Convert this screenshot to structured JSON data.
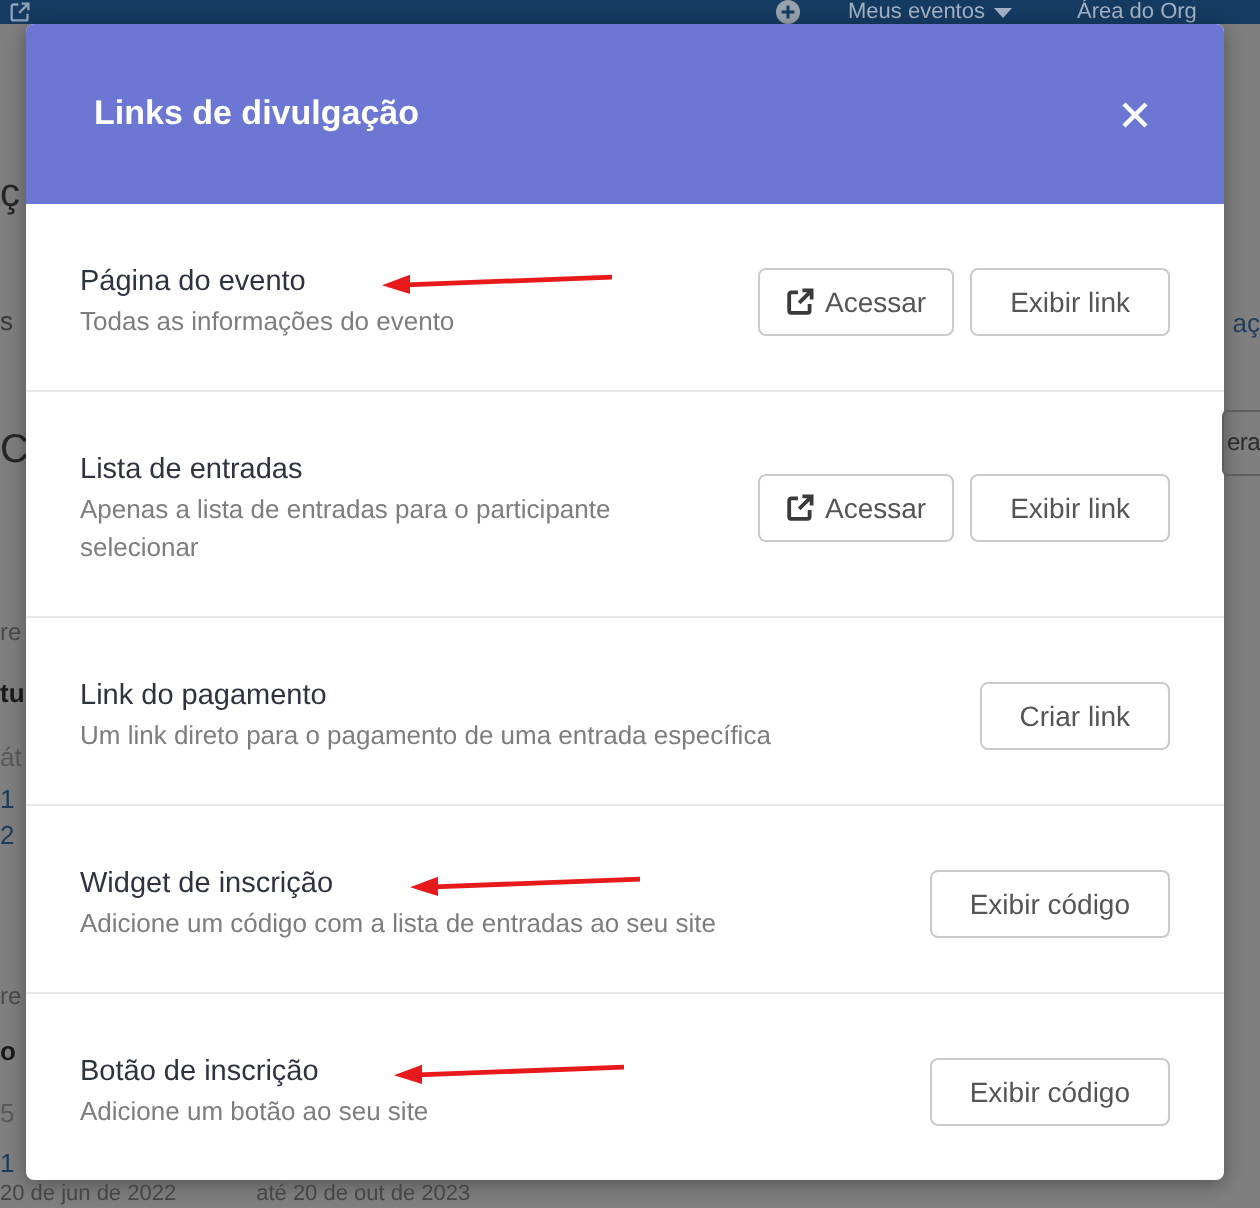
{
  "background": {
    "top_bar": {
      "links": [
        {
          "label": "Meus eventos",
          "dropdown": true
        },
        {
          "label": "Área do Org",
          "dropdown": false
        }
      ]
    },
    "left_fragments": [
      {
        "text": "ç",
        "kind": "heading"
      },
      {
        "text": "s",
        "kind": "text"
      },
      {
        "text": "C",
        "kind": "heading"
      },
      {
        "text": "re",
        "kind": "small"
      },
      {
        "text": "tu",
        "kind": "bold"
      },
      {
        "text": "át",
        "kind": "muted"
      },
      {
        "text": "1",
        "kind": "link"
      },
      {
        "text": "2",
        "kind": "link"
      },
      {
        "text": "re",
        "kind": "small"
      },
      {
        "text": "o",
        "kind": "bold"
      },
      {
        "text": "5",
        "kind": "muted"
      },
      {
        "text": "1",
        "kind": "link"
      }
    ],
    "right_fragments": [
      {
        "text": "aç",
        "kind": "link"
      },
      {
        "text": "era",
        "kind": "button"
      }
    ],
    "bottom_texts": [
      "20 de jun de 2022",
      "até 20 de out de 2023"
    ]
  },
  "dialog": {
    "title": "Links de divulgação",
    "rows": [
      {
        "title": "Página do evento",
        "description": "Todas as informações do evento",
        "annotated": true,
        "buttons": [
          {
            "label": "Acessar",
            "kind": "open"
          },
          {
            "label": "Exibir link",
            "kind": "plain"
          }
        ]
      },
      {
        "title": "Lista de entradas",
        "description": "Apenas a lista de entradas para o participante selecionar",
        "annotated": false,
        "buttons": [
          {
            "label": "Acessar",
            "kind": "open"
          },
          {
            "label": "Exibir link",
            "kind": "plain"
          }
        ]
      },
      {
        "title": "Link do pagamento",
        "description": "Um link direto para o pagamento de uma entrada específica",
        "annotated": false,
        "buttons": [
          {
            "label": "Criar link",
            "kind": "plain"
          }
        ]
      },
      {
        "title": "Widget de inscrição",
        "description": "Adicione um código com a lista de entradas ao seu site",
        "annotated": true,
        "buttons": [
          {
            "label": "Exibir código",
            "kind": "plain"
          }
        ]
      },
      {
        "title": "Botão de inscrição",
        "description": "Adicione um botão ao seu site",
        "annotated": true,
        "buttons": [
          {
            "label": "Exibir código",
            "kind": "plain"
          }
        ]
      }
    ]
  }
}
